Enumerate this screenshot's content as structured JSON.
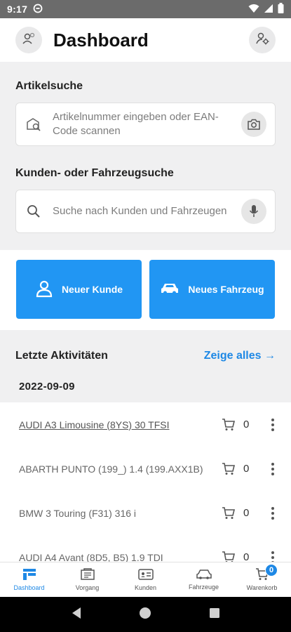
{
  "status_bar": {
    "time": "9:17"
  },
  "header": {
    "title": "Dashboard"
  },
  "article_search": {
    "label": "Artikelsuche",
    "placeholder": "Artikelnummer eingeben oder EAN-Code scannen"
  },
  "customer_search": {
    "label": "Kunden- oder Fahrzeugsuche",
    "placeholder": "Suche nach Kunden und Fahrzeugen"
  },
  "actions": {
    "new_customer": "Neuer Kunde",
    "new_vehicle": "Neues Fahrzeug"
  },
  "activities": {
    "label": "Letzte Aktivitäten",
    "show_all": "Zeige alles",
    "date": "2022-09-09",
    "items": [
      {
        "name": "AUDI A3 Limousine (8YS) 30 TFSI",
        "qty": "0"
      },
      {
        "name": "ABARTH PUNTO (199_) 1.4 (199.AXX1B)",
        "qty": "0"
      },
      {
        "name": "BMW 3 Touring (F31) 316 i",
        "qty": "0"
      },
      {
        "name": "AUDI A4 Avant (8D5, B5) 1.9 TDI",
        "qty": "0"
      }
    ]
  },
  "bottom_nav": {
    "dashboard": "Dashboard",
    "vorgang": "Vorgang",
    "kunden": "Kunden",
    "fahrzeuge": "Fahrzeuge",
    "warenkorb": "Warenkorb",
    "cart_badge": "0"
  },
  "colors": {
    "accent": "#2196f3",
    "link": "#1e88e5"
  }
}
